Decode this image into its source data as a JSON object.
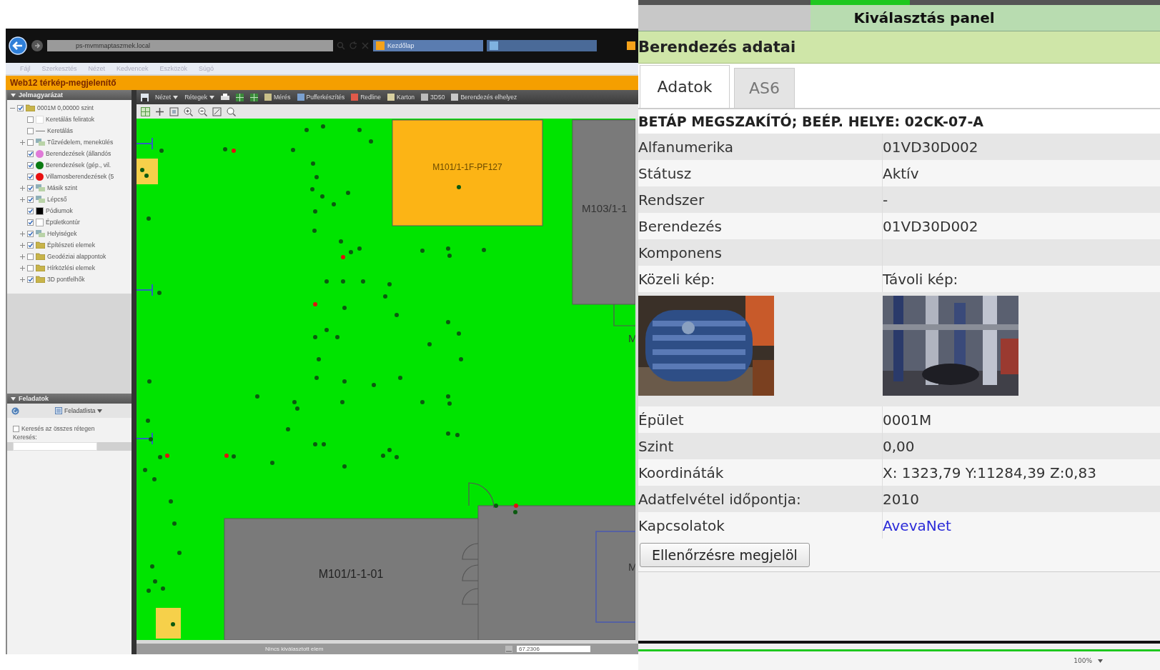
{
  "browser": {
    "address": "ps-mvmmaptaszmek.local",
    "tabs": [
      {
        "label": "Kezdőlap",
        "selected": true
      },
      {
        "selected": false
      }
    ],
    "menu": [
      "Fájl",
      "Szerkesztés",
      "Nézet",
      "Kedvencek",
      "Eszközök",
      "Súgó"
    ]
  },
  "app": {
    "title": "Web12 térkép-megjelenítő"
  },
  "legend": {
    "title": "Jelmagyarázat",
    "tree": [
      {
        "label": "0001M 0,00000 szint",
        "kind": "folder",
        "checked": true,
        "expanded": true,
        "children": [
          {
            "label": "Keretálás feliratok",
            "kind": "blank",
            "checked": false
          },
          {
            "label": "Keretálás",
            "kind": "line",
            "checked": false
          },
          {
            "label": "Tűzvédelem, menekülés",
            "kind": "layers",
            "checked": false,
            "expanded": false
          },
          {
            "label": "Berendezések (állandós",
            "kind": "swatch",
            "color": "#e07ad8",
            "checked": true
          },
          {
            "label": "Berendezések (gép., vil.",
            "kind": "swatch",
            "color": "#0a7a12",
            "checked": true
          },
          {
            "label": "Villamosberendezések (5",
            "kind": "swatch",
            "color": "#e81010",
            "checked": true
          },
          {
            "label": "Másik szint",
            "kind": "layers",
            "checked": true,
            "expanded": false
          },
          {
            "label": "Lépcső",
            "kind": "layers",
            "checked": true,
            "expanded": false
          },
          {
            "label": "Pódiumok",
            "kind": "square",
            "color": "#000000",
            "checked": true
          },
          {
            "label": "Épületkontúr",
            "kind": "square",
            "color": "#ffffff",
            "checked": true
          },
          {
            "label": "Helyiségek",
            "kind": "layers",
            "checked": true,
            "expanded": false
          },
          {
            "label": "Építészeti elemek",
            "kind": "folder",
            "checked": true,
            "expanded": false
          },
          {
            "label": "Geodéziai alappontok",
            "kind": "folder",
            "checked": false,
            "expanded": false
          },
          {
            "label": "Hírközlési elemek",
            "kind": "folder",
            "checked": false,
            "expanded": false
          },
          {
            "label": "3D pontfelhők",
            "kind": "folder",
            "checked": true,
            "expanded": false
          }
        ]
      }
    ]
  },
  "tasks": {
    "title": "Feladatok",
    "list_button": "Feladatlista",
    "search_all": {
      "label": "Keresés az összes rétegen",
      "checked": false
    },
    "search_label": "Keresés:"
  },
  "toolbar": {
    "items": [
      {
        "label": "Nézet",
        "dropdown": true
      },
      {
        "label": "Rétegek",
        "dropdown": true
      },
      {
        "label": "Mérés",
        "dropdown": false
      },
      {
        "label": "Pufferkészítés",
        "dropdown": false
      },
      {
        "label": "Redline",
        "dropdown": false
      },
      {
        "label": "Karton",
        "dropdown": false
      },
      {
        "label": "3D50",
        "dropdown": false
      },
      {
        "label": "Berendezés elhelyez",
        "dropdown": false
      }
    ]
  },
  "map": {
    "room_labels": [
      "M101/1-1F-PF127",
      "M103/1-1",
      "M",
      "M101/1-1-01",
      "M"
    ]
  },
  "status_bar": {
    "message": "Nincs kiválasztott elem",
    "scale": "67.2306"
  },
  "selection_panel": {
    "title": "Kiválasztás panel",
    "section": "Berendezés adatai",
    "tabs": [
      {
        "label": "Adatok",
        "selected": true
      },
      {
        "label": "AS6",
        "selected": false
      }
    ],
    "record_title": "BETÁP MEGSZAKÍTÓ; BEÉP. HELYE: 02CK-07-A",
    "rows": [
      {
        "kind": "text",
        "label": "Alfanumerika",
        "value": "01VD30D002"
      },
      {
        "kind": "text",
        "label": "Státusz",
        "value": "Aktív"
      },
      {
        "kind": "text",
        "label": "Rendszer",
        "value": "-"
      },
      {
        "kind": "text",
        "label": "Berendezés",
        "value": "01VD30D002"
      },
      {
        "kind": "text",
        "label": "Komponens"
      },
      {
        "kind": "photos",
        "labels": [
          "Közeli kép:",
          "Távoli kép:"
        ]
      },
      {
        "kind": "text",
        "label": "Épület",
        "value": "0001M"
      },
      {
        "kind": "text",
        "label": "Szint",
        "value": "0,00"
      },
      {
        "kind": "text",
        "label": "Koordináták",
        "value": "X: 1323,79 Y:11284,39 Z:0,83"
      },
      {
        "kind": "text",
        "label": "Adatfelvétel időpontja:",
        "value": "2010"
      },
      {
        "kind": "link",
        "label": "Kapcsolatok",
        "value": "AvevaNet"
      }
    ],
    "button": "Ellenőrzésre megjelöl"
  },
  "zoom": "100%"
}
